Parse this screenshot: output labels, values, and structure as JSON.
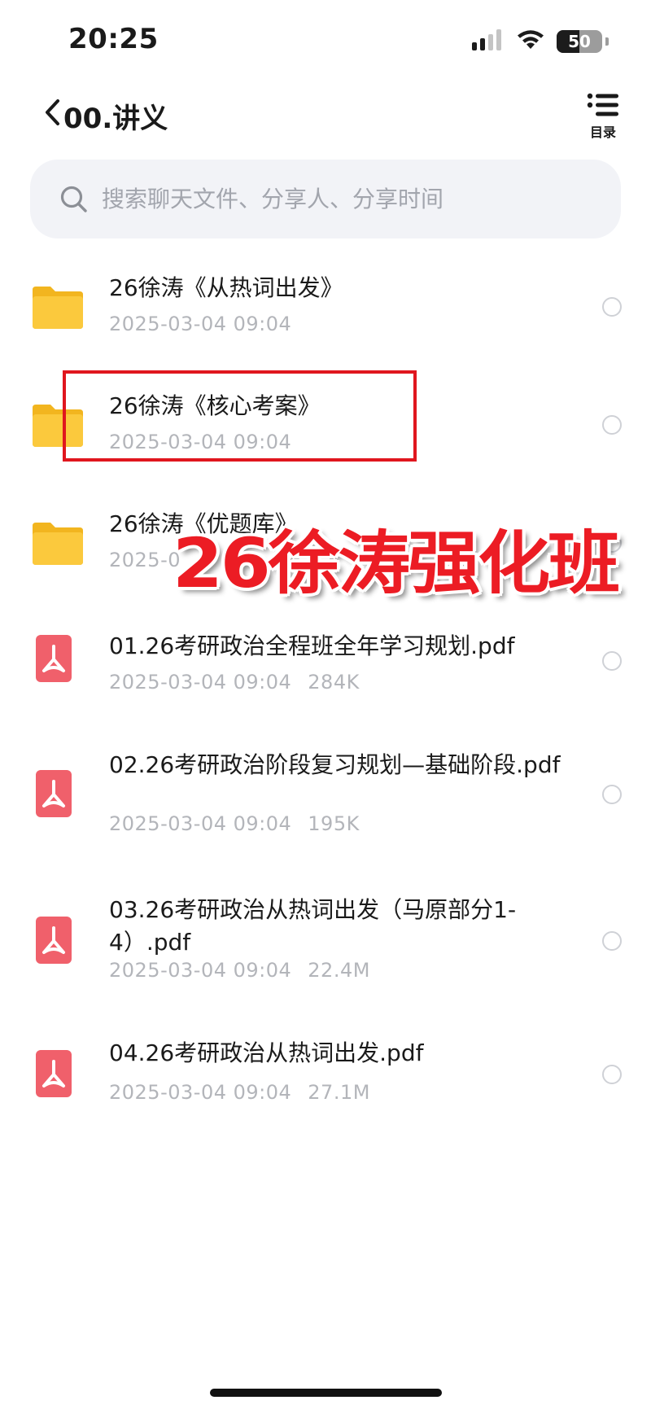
{
  "status_bar": {
    "time": "20:25",
    "battery_level": "50",
    "battery_fraction": 0.5
  },
  "nav": {
    "title": "00.讲义",
    "toc_label": "目录"
  },
  "search": {
    "placeholder": "搜索聊天文件、分享人、分享时间",
    "value": ""
  },
  "files": [
    {
      "type": "folder",
      "name": "26徐涛《从热词出发》",
      "date": "2025-03-04 09:04",
      "size": ""
    },
    {
      "type": "folder",
      "name": "26徐涛《核心考案》",
      "date": "2025-03-04 09:04",
      "size": ""
    },
    {
      "type": "folder",
      "name": "26徐涛《优题库》",
      "date": "2025-0",
      "size": ""
    },
    {
      "type": "pdf",
      "name": "01.26考研政治全程班全年学习规划.pdf",
      "date": "2025-03-04 09:04",
      "size": "284K"
    },
    {
      "type": "pdf",
      "name": "02.26考研政治阶段复习规划—基础阶段.pdf",
      "date": "2025-03-04 09:04",
      "size": "195K"
    },
    {
      "type": "pdf",
      "name": "03.26考研政治从热词出发（马原部分1-4）.pdf",
      "date": "2025-03-04 09:04",
      "size": "22.4M"
    },
    {
      "type": "pdf",
      "name": "04.26考研政治从热词出发.pdf",
      "date": "2025-03-04 09:04",
      "size": "27.1M"
    }
  ],
  "overlay": {
    "text": "26徐涛强化班"
  },
  "colors": {
    "folder": "#fbc93d",
    "folder_dark": "#f2b51f",
    "pdf": "#f0606b",
    "highlight": "#e0161e",
    "overlay_text": "#ec1c24",
    "search_bg": "#f2f3f7",
    "meta_text": "#b3b5ba"
  }
}
